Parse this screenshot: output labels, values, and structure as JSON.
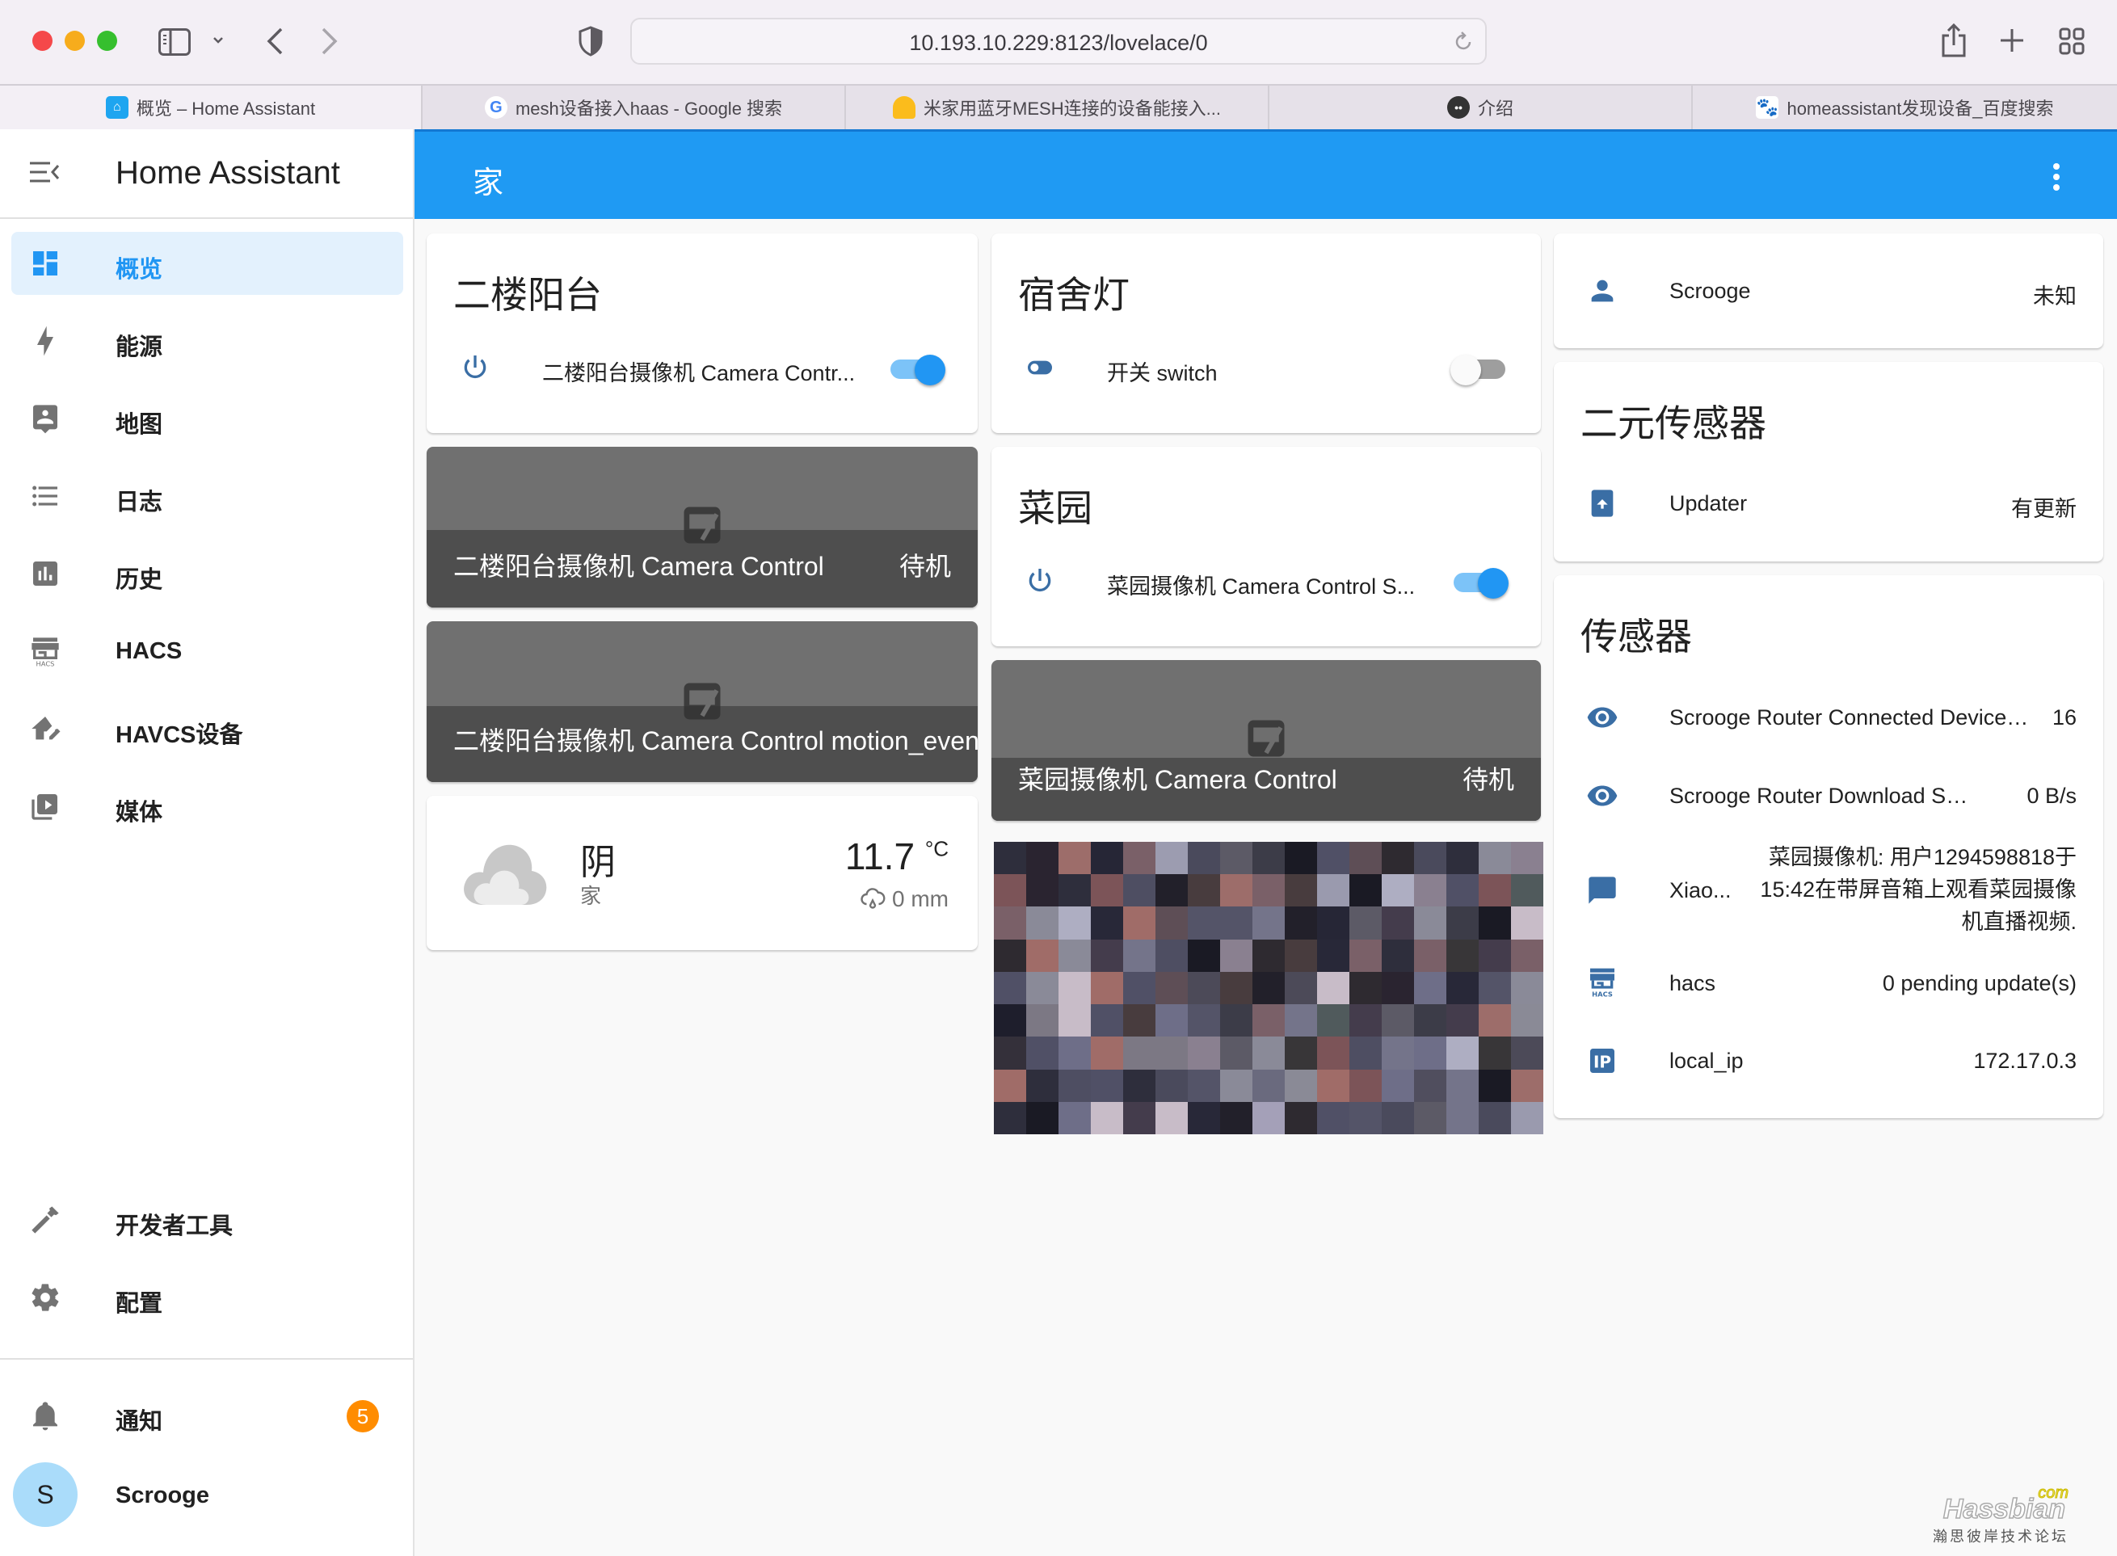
{
  "browser": {
    "url": "10.193.10.229:8123/lovelace/0",
    "tabs": [
      {
        "title": "概览 – Home Assistant",
        "icon": "home-assistant-favicon",
        "active": true
      },
      {
        "title": "mesh设备接入haas - Google 搜索",
        "icon": "google-favicon",
        "active": false
      },
      {
        "title": "米家用蓝牙MESH连接的设备能接入...",
        "icon": "lightbulb-favicon",
        "active": false
      },
      {
        "title": "介绍",
        "icon": "mascot-favicon",
        "active": false
      },
      {
        "title": "homeassistant发现设备_百度搜索",
        "icon": "baidu-favicon",
        "active": false
      }
    ]
  },
  "sidebar": {
    "title": "Home Assistant",
    "items": [
      {
        "label": "概览",
        "icon": "dashboard-icon",
        "active": true
      },
      {
        "label": "能源",
        "icon": "lightning-bolt-icon"
      },
      {
        "label": "地图",
        "icon": "map-account-icon"
      },
      {
        "label": "日志",
        "icon": "logbook-list-icon"
      },
      {
        "label": "历史",
        "icon": "history-chart-icon"
      },
      {
        "label": "HACS",
        "icon": "hacs-store-icon"
      },
      {
        "label": "HAVCS设备",
        "icon": "home-edit-icon"
      },
      {
        "label": "媒体",
        "icon": "media-play-icon"
      }
    ],
    "bottom_items": [
      {
        "label": "开发者工具",
        "icon": "hammer-icon"
      },
      {
        "label": "配置",
        "icon": "gear-icon"
      }
    ],
    "notifications": {
      "label": "通知",
      "icon": "bell-icon",
      "count": "5"
    },
    "user": {
      "name": "Scrooge",
      "initial": "S"
    }
  },
  "header": {
    "title": "家"
  },
  "colors": {
    "primary": "#1f9af3",
    "badge": "#ff8c00",
    "icon_blue": "#3a6ea5"
  },
  "cards": {
    "balcony": {
      "title": "二楼阳台",
      "entity": {
        "name": "二楼阳台摄像机 Camera Contr...",
        "icon": "power-icon",
        "state": "on"
      }
    },
    "balcony_cam": {
      "name": "二楼阳台摄像机 Camera Control",
      "state": "待机"
    },
    "balcony_motion": {
      "name": "二楼阳台摄像机 Camera Control motion_event"
    },
    "weather": {
      "condition": "阴",
      "location": "家",
      "temperature": "11.7",
      "unit": "°C",
      "precipitation": "0 mm",
      "icon": "cloudy-icon"
    },
    "dorm": {
      "title": "宿舍灯",
      "entity": {
        "name": "开关 switch",
        "icon": "toggle-switch-icon",
        "state": "off"
      }
    },
    "garden": {
      "title": "菜园",
      "entity": {
        "name": "菜园摄像机 Camera Control S...",
        "icon": "power-icon",
        "state": "on"
      }
    },
    "garden_cam": {
      "name": "菜园摄像机 Camera Control",
      "state": "待机"
    },
    "person": {
      "name": "Scrooge",
      "state": "未知",
      "icon": "account-icon"
    },
    "binary": {
      "title": "二元传感器",
      "entity": {
        "name": "Updater",
        "state": "有更新",
        "icon": "package-up-icon"
      }
    },
    "sensors": {
      "title": "传感器",
      "rows": [
        {
          "name": "Scrooge Router Connected Device ...",
          "state": "16",
          "icon": "eye-icon"
        },
        {
          "name": "Scrooge Router Download Speed",
          "state": "0 B/s",
          "icon": "eye-icon"
        },
        {
          "name": "Xiao...",
          "state": "菜园摄像机: 用户1294598818于15:42在带屏音箱上观看菜园摄像机直播视频.",
          "icon": "message-icon"
        },
        {
          "name": "hacs",
          "state": "0 pending update(s)",
          "icon": "hacs-icon"
        },
        {
          "name": "local_ip",
          "state": "172.17.0.3",
          "icon": "ip-icon"
        }
      ]
    }
  },
  "watermark": {
    "brand": "Hassbian",
    "com": "com",
    "sub": "瀚思彼岸技术论坛"
  }
}
